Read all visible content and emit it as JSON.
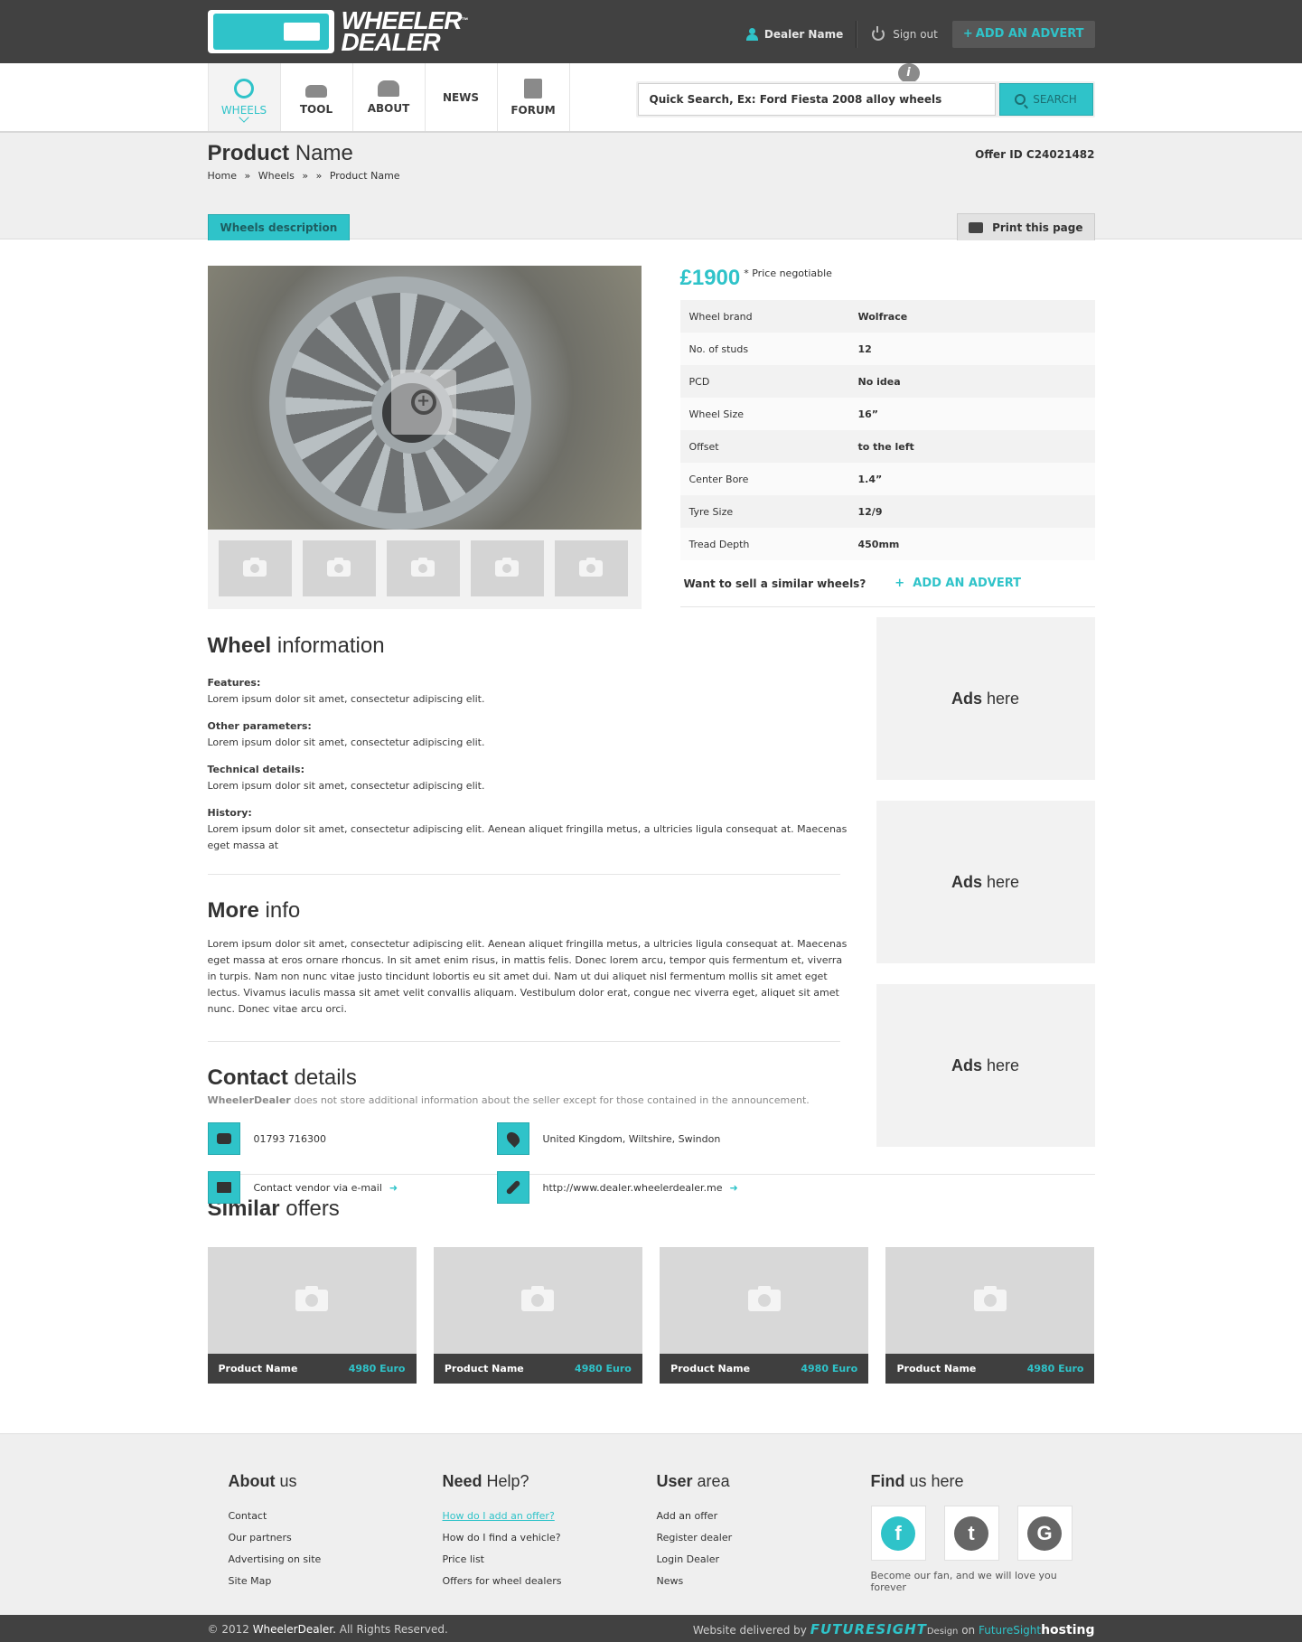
{
  "header": {
    "logo_text_1": "WHEELER",
    "logo_text_2": "DEALER",
    "logo_tm": "™",
    "user_name": "Dealer Name",
    "sign_out": "Sign out",
    "add_advert": "ADD AN ADVERT"
  },
  "nav": {
    "items": [
      {
        "label": "WHEELS",
        "icon": "wheel-icon"
      },
      {
        "label": "TOOL",
        "icon": "car-icon"
      },
      {
        "label": "ABOUT",
        "icon": "people-icon"
      },
      {
        "label": "NEWS",
        "icon": "info-icon"
      },
      {
        "label": "FORUM",
        "icon": "forum-icon"
      }
    ],
    "search_placeholder": "Quick Search, Ex: Ford Fiesta 2008 alloy wheels",
    "search_button": "SEARCH"
  },
  "product": {
    "title_bold": "Product",
    "title_rest": "Name",
    "breadcrumb": [
      "Home",
      "»",
      "Wheels",
      "»",
      "»",
      "Product Name"
    ],
    "offer_id": "Offer ID C24021482",
    "tab_label": "Wheels description",
    "print_label": "Print this page",
    "price": "£1900",
    "price_note": "* Price negotiable",
    "specs": [
      {
        "k": "Wheel brand",
        "v": "Wolfrace"
      },
      {
        "k": "No. of studs",
        "v": "12"
      },
      {
        "k": "PCD",
        "v": "No idea"
      },
      {
        "k": "Wheel Size",
        "v": "16”"
      },
      {
        "k": "Offset",
        "v": "to the left"
      },
      {
        "k": "Center Bore",
        "v": "1.4”"
      },
      {
        "k": "Tyre Size",
        "v": "12/9"
      },
      {
        "k": "Tread Depth",
        "v": "450mm"
      }
    ],
    "sell_question": "Want to sell a similar wheels?",
    "sell_link": "ADD AN ADVERT"
  },
  "wheel_info": {
    "title_bold": "Wheel",
    "title_rest": "information",
    "blocks": [
      {
        "h": "Features:",
        "t": "Lorem ipsum dolor sit amet, consectetur adipiscing elit."
      },
      {
        "h": "Other parameters:",
        "t": "Lorem ipsum dolor sit amet, consectetur adipiscing elit."
      },
      {
        "h": "Technical details:",
        "t": "Lorem ipsum dolor sit amet, consectetur adipiscing elit."
      },
      {
        "h": "History:",
        "t": "Lorem ipsum dolor sit amet, consectetur adipiscing elit. Aenean aliquet fringilla metus, a ultricies ligula consequat at. Maecenas eget massa at"
      }
    ]
  },
  "more_info": {
    "title_bold": "More",
    "title_rest": "info",
    "text": "Lorem ipsum dolor sit amet, consectetur adipiscing elit. Aenean aliquet fringilla metus, a ultricies ligula consequat at. Maecenas eget massa at eros ornare rhoncus. In sit amet enim risus, in mattis felis. Donec lorem arcu, tempor quis fermentum et, viverra in turpis. Nam non nunc vitae justo tincidunt lobortis eu sit amet dui. Nam ut dui aliquet nisl fermentum mollis sit amet eget lectus. Vivamus iaculis massa sit amet velit convallis aliquam. Vestibulum dolor erat, congue nec viverra eget, aliquet sit amet nunc. Donec vitae arcu orci."
  },
  "contact": {
    "title_bold": "Contact",
    "title_rest": "details",
    "note_brand": "WheelerDealer",
    "note_rest": "does not store additional information about the seller except for those contained in the announcement.",
    "phone": "01793 716300",
    "location": "United Kingdom, Wiltshire, Swindon",
    "email": "Contact vendor via e-mail",
    "website": "http://www.dealer.wheelerdealer.me"
  },
  "ads": {
    "bold": "Ads",
    "rest": "here"
  },
  "similar": {
    "title_bold": "Similar",
    "title_rest": "offers",
    "cards": [
      {
        "name": "Product Name",
        "price": "4980 Euro"
      },
      {
        "name": "Product Name",
        "price": "4980 Euro"
      },
      {
        "name": "Product Name",
        "price": "4980 Euro"
      },
      {
        "name": "Product Name",
        "price": "4980 Euro"
      }
    ]
  },
  "footer": {
    "cols": [
      {
        "bold": "About",
        "rest": "us",
        "links": [
          "Contact",
          "Our partners",
          "Advertising on site",
          "Site Map"
        ]
      },
      {
        "bold": "Need",
        "rest": "Help?",
        "links": [
          "How do I add an offer?",
          "How do I find a vehicle?",
          "Price list",
          "Offers for wheel dealers"
        ]
      },
      {
        "bold": "User",
        "rest": "area",
        "links": [
          "Add an offer",
          "Register dealer",
          "Login Dealer",
          "News"
        ]
      }
    ],
    "find_bold": "Find",
    "find_rest": "us here",
    "fan_text": "Become our fan, and we will love you forever",
    "copyright_pre": "© 2012",
    "copyright_brand": "WheelerDealer.",
    "copyright_post": "All Rights Reserved.",
    "delivered": "Website delivered by",
    "futuresight": "FUTURESIGHT",
    "design": "Design",
    "on": "on",
    "futuresight2": "FutureSight",
    "hosting": "hosting"
  },
  "colors": {
    "accent": "#2fc3c9",
    "dark": "#414141"
  }
}
